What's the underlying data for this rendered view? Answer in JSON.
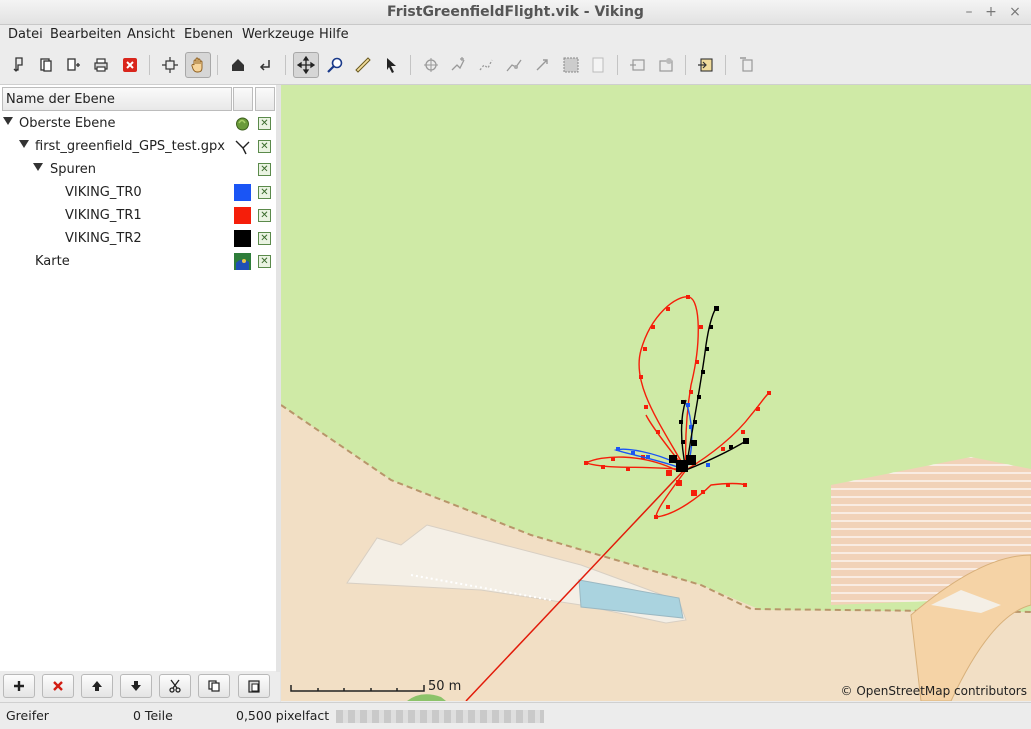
{
  "window": {
    "title": "FristGreenfieldFlight.vik - Viking",
    "minimize": "–",
    "maximize": "+",
    "close": "×"
  },
  "menu": [
    "Datei",
    "Bearbeiten",
    "Ansicht",
    "Ebenen",
    "Werkzeuge",
    "Hilfe"
  ],
  "toolbar": {
    "buttons": [
      "new-file-icon",
      "open-icon",
      "append-icon",
      "print-icon",
      "quit-icon",
      "pan-icon",
      "drag-hand-icon",
      "home-icon",
      "back-icon",
      "pan-tool-icon",
      "zoom-icon",
      "ruler-icon",
      "select-icon",
      "create-waypoint-icon",
      "add-track-icon",
      "route-icon",
      "edit-trackpoint-icon",
      "edit-waypoint-icon",
      "map-download-icon",
      "map-info-icon",
      "layer-properties-icon",
      "layer-visibility-icon",
      "export-icon",
      "delete-layer-icon"
    ],
    "active": "drag-hand-icon"
  },
  "layers_panel": {
    "header": "Name der Ebene",
    "rows": [
      {
        "label": "Oberste Ebene",
        "level": 0,
        "expander": true,
        "swatch": "aggregate-icon",
        "checked": true
      },
      {
        "label": "first_greenfield_GPS_test.gpx",
        "level": 1,
        "expander": true,
        "swatch": "trw-layer-icon",
        "checked": true
      },
      {
        "label": "Spuren",
        "level": 2,
        "expander": true,
        "swatch": "",
        "checked": true
      },
      {
        "label": "VIKING_TR0",
        "level": 3,
        "expander": false,
        "swatch": "#1a55f5",
        "checked": true
      },
      {
        "label": "VIKING_TR1",
        "level": 3,
        "expander": false,
        "swatch": "#f51e0a",
        "checked": true
      },
      {
        "label": "VIKING_TR2",
        "level": 3,
        "expander": false,
        "swatch": "#000000",
        "checked": true
      },
      {
        "label": "Karte",
        "level": 1,
        "expander": false,
        "swatch": "map-layer-icon",
        "checked": true
      }
    ],
    "bottom_buttons": [
      "add-layer-icon",
      "remove-layer-icon",
      "move-up-icon",
      "move-down-icon",
      "cut-icon",
      "copy-icon",
      "paste-icon"
    ]
  },
  "map": {
    "scale_label": "50 m",
    "attribution": "© OpenStreetMap contributors",
    "colors": {
      "grass": "#cfeaa6",
      "ground": "#f2dfc5",
      "water": "#aad3df",
      "track0": "#1a55f5",
      "track1": "#f51e0a",
      "track2": "#000000"
    }
  },
  "status": {
    "tool": "Greifer",
    "items": "0 Teile",
    "zoom": "0,500 pixelfact"
  }
}
